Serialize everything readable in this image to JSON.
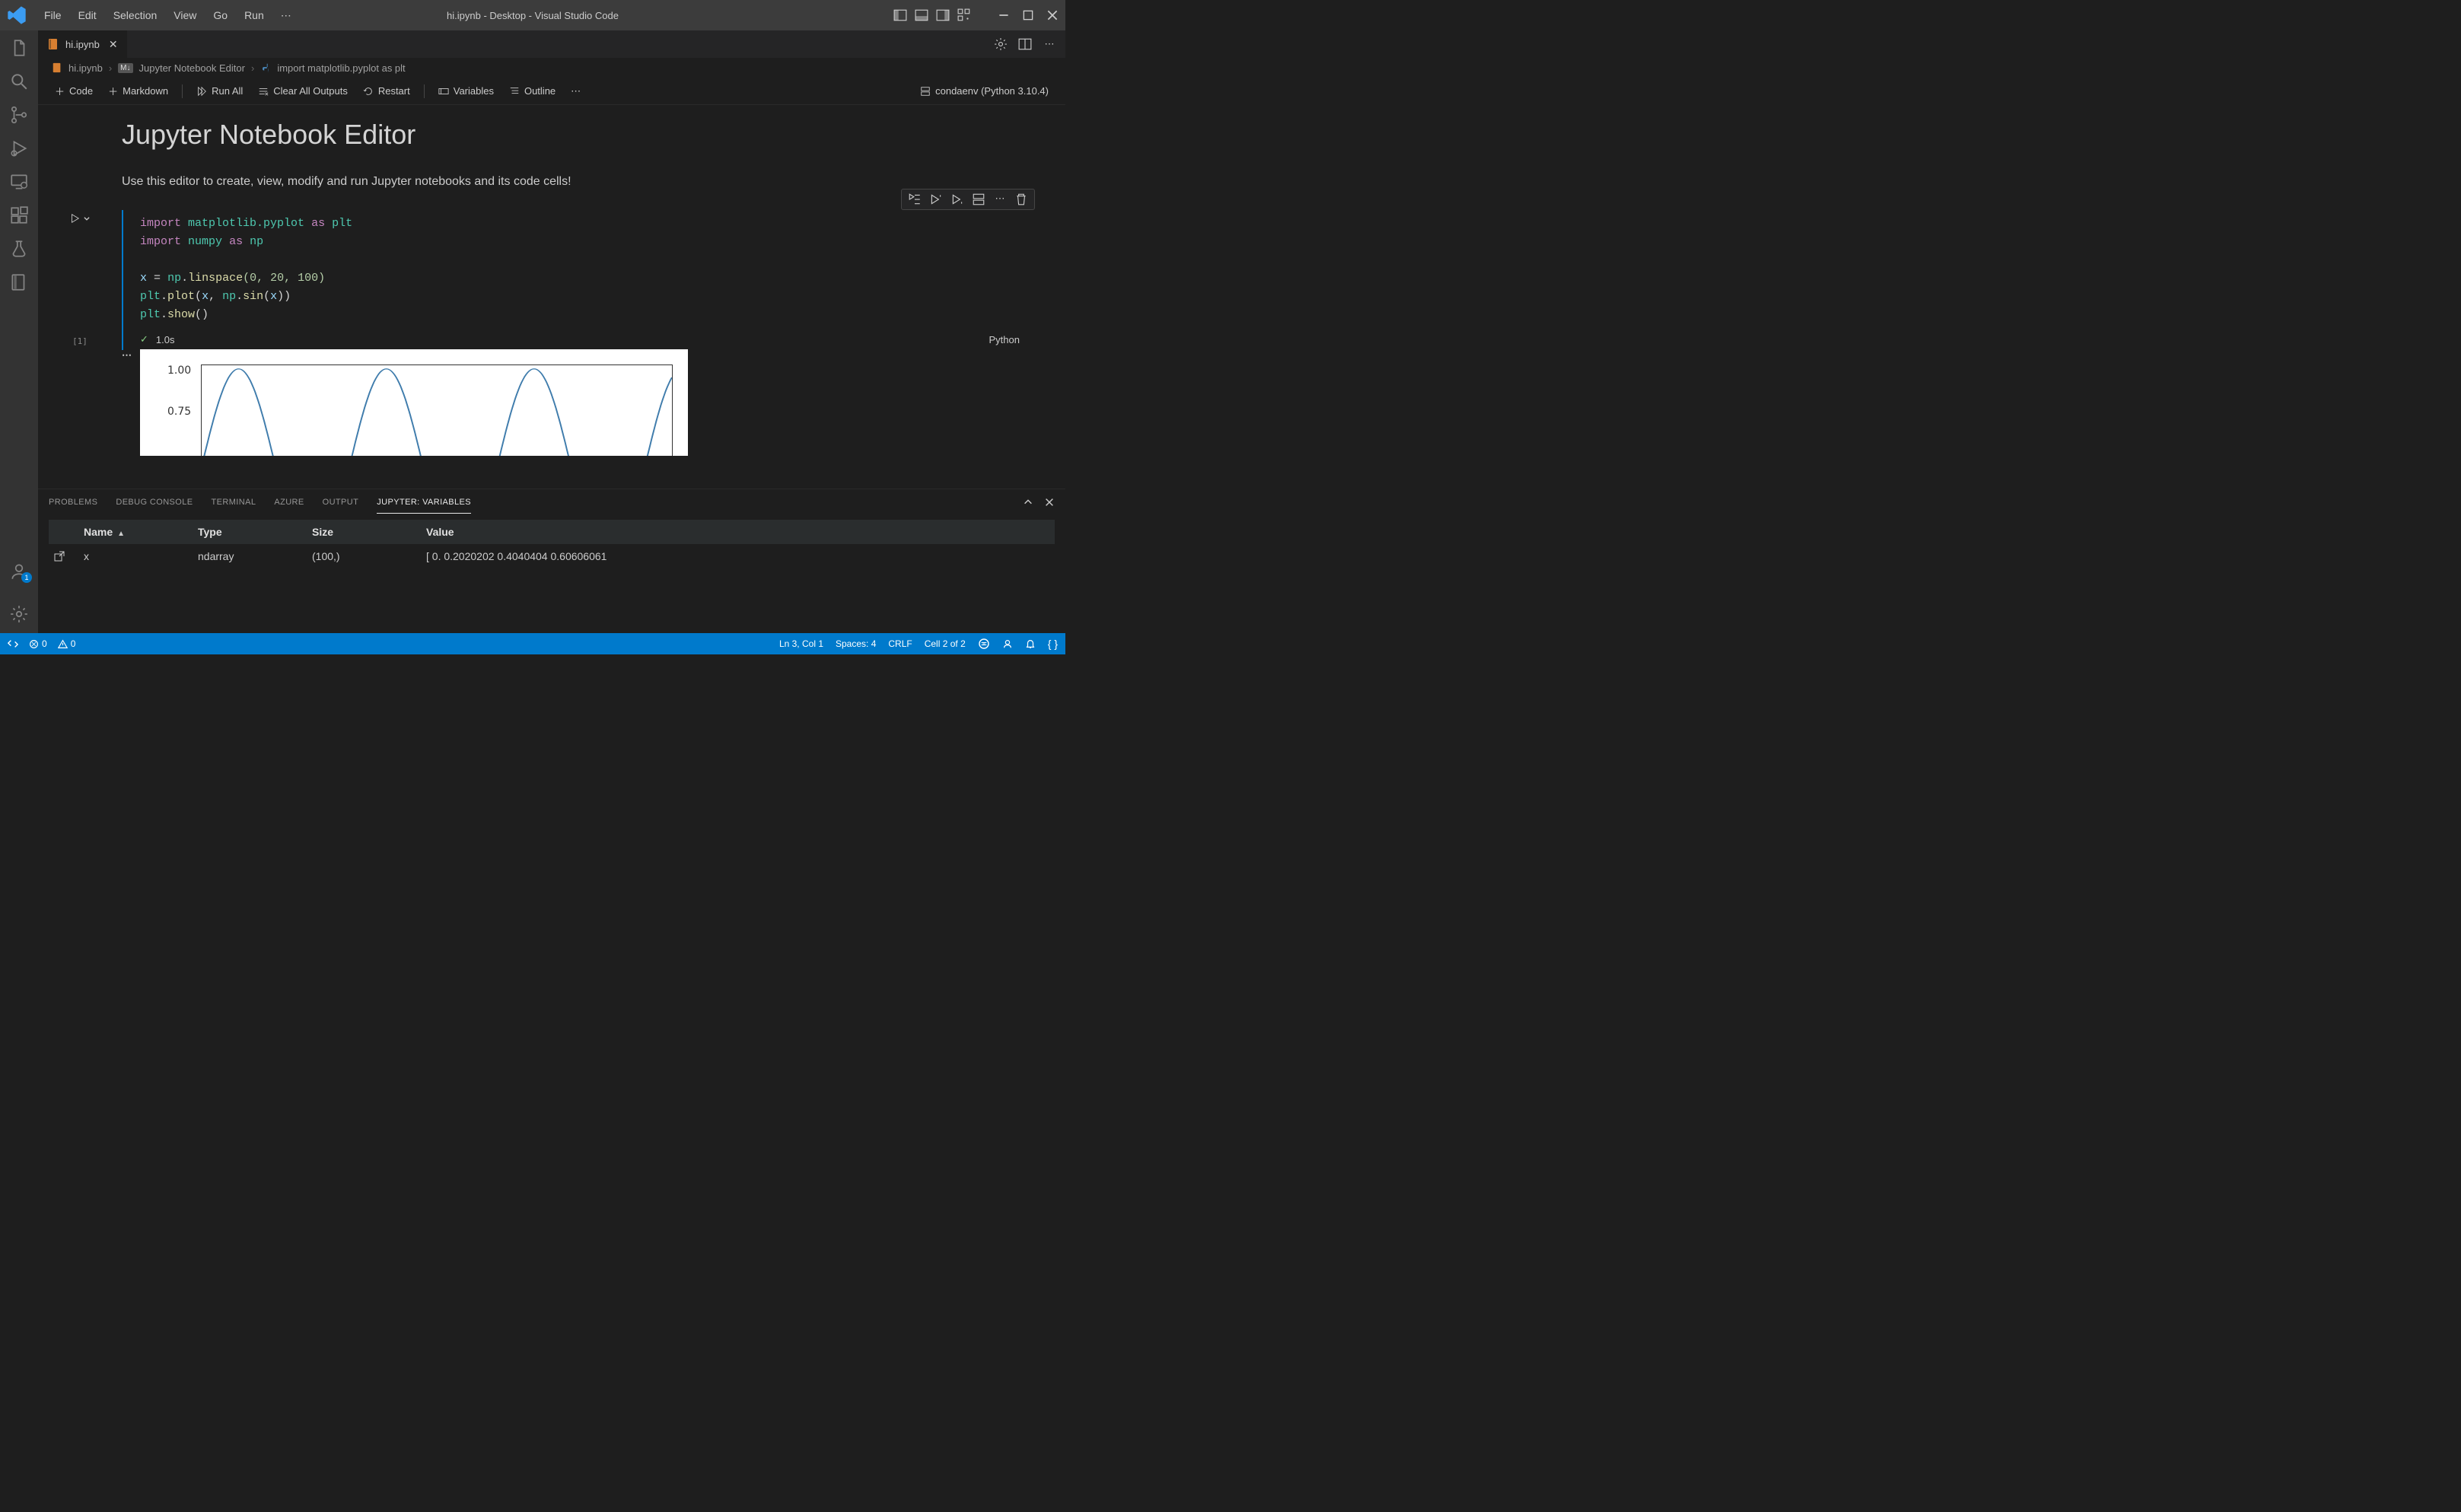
{
  "window": {
    "title": "hi.ipynb - Desktop - Visual Studio Code"
  },
  "menu": [
    "File",
    "Edit",
    "Selection",
    "View",
    "Go",
    "Run"
  ],
  "tab": {
    "label": "hi.ipynb"
  },
  "breadcrumb": {
    "file": "hi.ipynb",
    "editor": "Jupyter Notebook Editor",
    "cell": "import matplotlib.pyplot as plt"
  },
  "nb_toolbar": {
    "code": "Code",
    "markdown": "Markdown",
    "run_all": "Run All",
    "clear": "Clear All Outputs",
    "restart": "Restart",
    "variables": "Variables",
    "outline": "Outline",
    "kernel": "condaenv (Python 3.10.4)"
  },
  "notebook": {
    "heading": "Jupyter Notebook Editor",
    "paragraph": "Use this editor to create, view, modify and run Jupyter notebooks and its code cells!",
    "code": {
      "line1_kw": "import",
      "line1_mod": "matplotlib.pyplot",
      "line1_as": "as",
      "line1_alias": "plt",
      "line2_kw": "import",
      "line2_mod": "numpy",
      "line2_as": "as",
      "line2_alias": "np",
      "line3_var": "x",
      "line3_eq": "=",
      "line3_mod": "np",
      "line3_dot1": ".",
      "line3_fn": "linspace",
      "line3_args": "(0, 20, 100)",
      "line4a": "plt",
      "line4_dot": ".",
      "line4_fn": "plot",
      "line4_open": "(",
      "line4_x": "x",
      "line4_c": ", ",
      "line4_np": "np",
      "line4_d2": ".",
      "line4_sin": "sin",
      "line4_op2": "(",
      "line4_x2": "x",
      "line4_cl": "))",
      "line5a": "plt",
      "line5_dot": ".",
      "line5_fn": "show",
      "line5_p": "()"
    },
    "exec_count": "[1]",
    "exec_time": "1.0s",
    "cell_lang": "Python"
  },
  "chart_data": {
    "type": "line",
    "title": "",
    "xlabel": "",
    "ylabel": "",
    "x_range": [
      0,
      20
    ],
    "y_range": [
      -1,
      1
    ],
    "visible_yticks": [
      "1.00",
      "0.75"
    ],
    "series": [
      {
        "name": "sin(x)",
        "expression": "y = sin(x), x = linspace(0,20,100)"
      }
    ],
    "note": "Only the top portion (y from ~0.64 to 1.0) of a sine plot is visible in viewport"
  },
  "panel": {
    "tabs": [
      "PROBLEMS",
      "DEBUG CONSOLE",
      "TERMINAL",
      "AZURE",
      "OUTPUT",
      "JUPYTER: VARIABLES"
    ],
    "active_tab": 5,
    "columns": [
      "Name",
      "Type",
      "Size",
      "Value"
    ],
    "rows": [
      {
        "name": "x",
        "type": "ndarray",
        "size": "(100,)",
        "value": "[ 0.          0.2020202   0.4040404   0.60606061"
      }
    ]
  },
  "status": {
    "remote_icon": "remote",
    "errors": "0",
    "warnings": "0",
    "ln": "Ln 3, Col 1",
    "spaces": "Spaces: 4",
    "eol": "CRLF",
    "cell": "Cell 2 of 2"
  },
  "activity_badge": "1"
}
